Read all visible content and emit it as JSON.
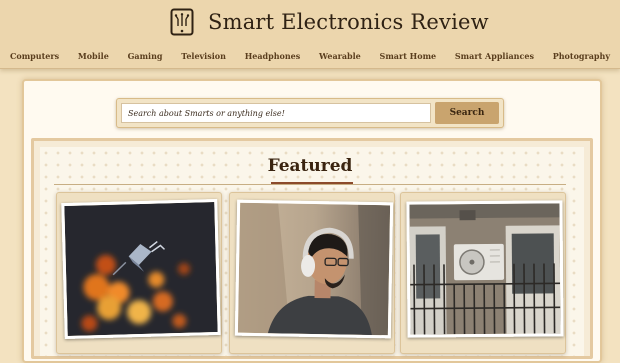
{
  "site": {
    "title": "Smart Electronics Review",
    "logo_icon": "tablet-circuit-icon"
  },
  "nav": {
    "items": [
      "Computers",
      "Mobile",
      "Gaming",
      "Television",
      "Headphones",
      "Wearable",
      "Smart Home",
      "Smart Appliances",
      "Photography"
    ]
  },
  "search": {
    "placeholder": "Search about Smarts or anything else!",
    "value": "",
    "button_label": "Search"
  },
  "featured": {
    "title": "Featured",
    "cards": [
      {
        "image": "bokeh-smart-plug-photo"
      },
      {
        "image": "man-with-headphones-photo"
      },
      {
        "image": "air-conditioner-unit-photo"
      }
    ]
  },
  "colors": {
    "accent": "#c9a46e",
    "header_bg": "#ecd6ad",
    "title_underline": "#8b4a2b"
  }
}
